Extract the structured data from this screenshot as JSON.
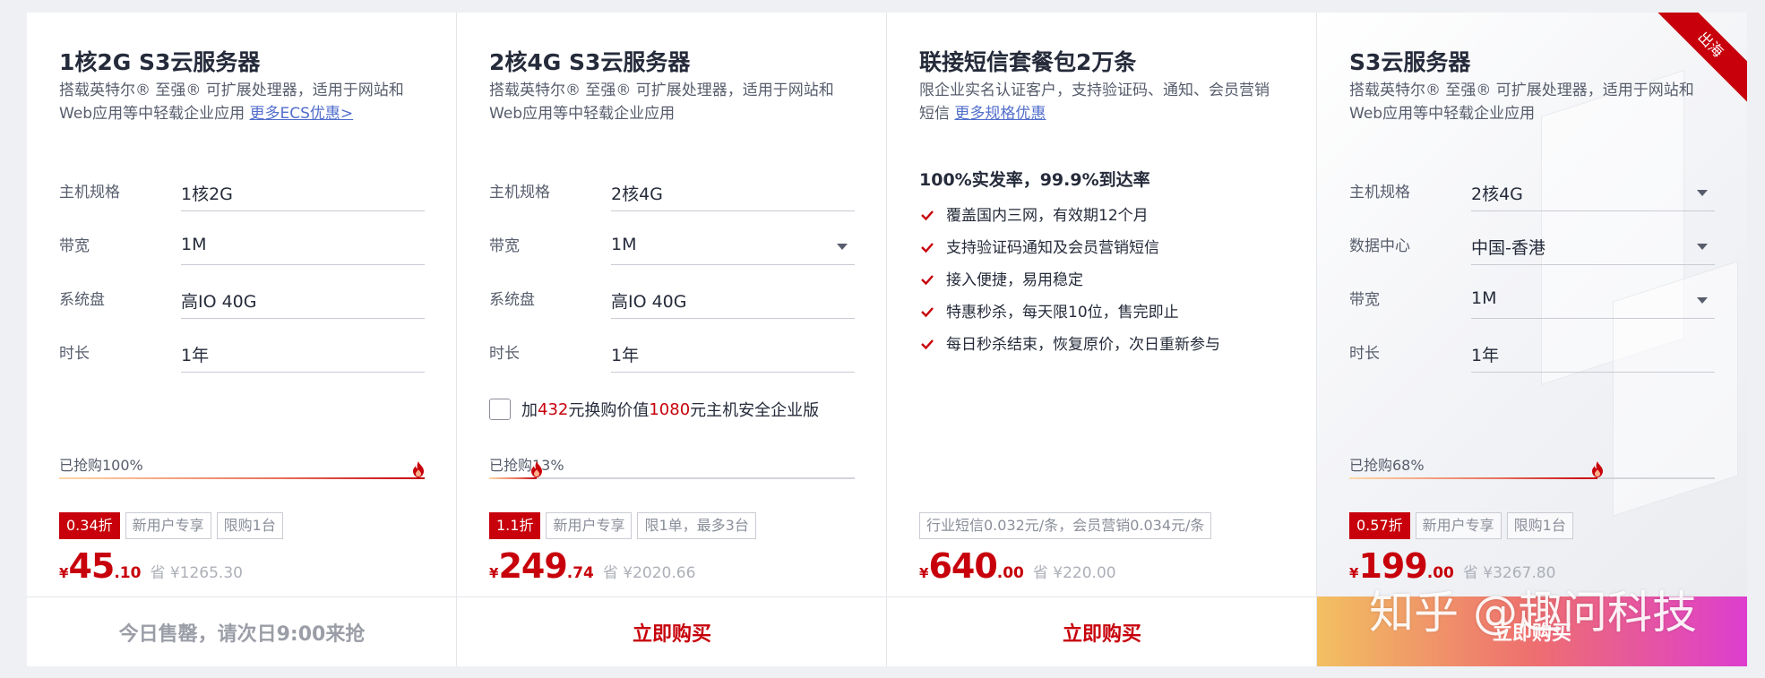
{
  "cards": [
    {
      "title": "1核2G S3云服务器",
      "desc": "搭载英特尔® 至强® 可扩展处理器，适用于网站和Web应用等中轻载企业应用",
      "desc_link": "更多ECS优惠>",
      "specs": [
        {
          "label": "主机规格",
          "value": "1核2G"
        },
        {
          "label": "带宽",
          "value": "1M"
        },
        {
          "label": "系统盘",
          "value": "高IO 40G"
        },
        {
          "label": "时长",
          "value": "1年"
        }
      ],
      "sold_text": "已抢购100%",
      "sold_fraction": 1.0,
      "tags": [
        "0.34折",
        "新用户专享",
        "限购1台"
      ],
      "price": {
        "currency": "¥",
        "int": "45",
        "dec": ".10",
        "save": "省 ¥1265.30"
      },
      "button": "今日售罄，请次日9:00来抢"
    },
    {
      "title": "2核4G S3云服务器",
      "desc": "搭载英特尔® 至强® 可扩展处理器，适用于网站和Web应用等中轻载企业应用",
      "specs": [
        {
          "label": "主机规格",
          "value": "2核4G"
        },
        {
          "label": "带宽",
          "value": "1M"
        },
        {
          "label": "系统盘",
          "value": "高IO 40G"
        },
        {
          "label": "时长",
          "value": "1年"
        }
      ],
      "addon": {
        "pre": "加",
        "a": "432",
        "mid": "元换购价值",
        "b": "1080",
        "post": "元主机安全企业版"
      },
      "sold_text": "已抢购13%",
      "sold_fraction": 0.13,
      "tags": [
        "1.1折",
        "新用户专享",
        "限1单，最多3台"
      ],
      "price": {
        "currency": "¥",
        "int": "249",
        "dec": ".74",
        "save": "省 ¥2020.66"
      },
      "button": "立即购买"
    },
    {
      "title": "联接短信套餐包2万条",
      "desc": "限企业实名认证客户，支持验证码、通知、会员营销短信",
      "desc_link": "更多规格优惠",
      "feature_head": "100%实发率，99.9%到达率",
      "features": [
        "覆盖国内三网，有效期12个月",
        "支持验证码通知及会员营销短信",
        "接入便捷，易用稳定",
        "特惠秒杀，每天限10位，售完即止",
        "每日秒杀结束，恢复原价，次日重新参与"
      ],
      "tags": [
        "行业短信0.032元/条，会员营销0.034元/条"
      ],
      "price": {
        "currency": "¥",
        "int": "640",
        "dec": ".00",
        "save": "省 ¥220.00"
      },
      "button": "立即购买"
    },
    {
      "title": "S3云服务器",
      "desc": "搭载英特尔® 至强® 可扩展处理器，适用于网站和Web应用等中轻载企业应用",
      "ribbon": "出海",
      "specs": [
        {
          "label": "主机规格",
          "value": "2核4G"
        },
        {
          "label": "数据中心",
          "value": "中国-香港"
        },
        {
          "label": "带宽",
          "value": "1M"
        },
        {
          "label": "时长",
          "value": "1年"
        }
      ],
      "sold_text": "已抢购68%",
      "sold_fraction": 0.68,
      "tags": [
        "0.57折",
        "新用户专享",
        "限购1台"
      ],
      "price": {
        "currency": "¥",
        "int": "199",
        "dec": ".00",
        "save": "省 ¥3267.80"
      },
      "button": "立即购买",
      "watermark": "知乎 @趣问科技"
    }
  ],
  "colors": {
    "accent": "#c7000b",
    "link": "#526ecc"
  },
  "icons": {
    "check": "check-icon",
    "flame": "flame-icon",
    "caret": "chevron-down-icon"
  }
}
